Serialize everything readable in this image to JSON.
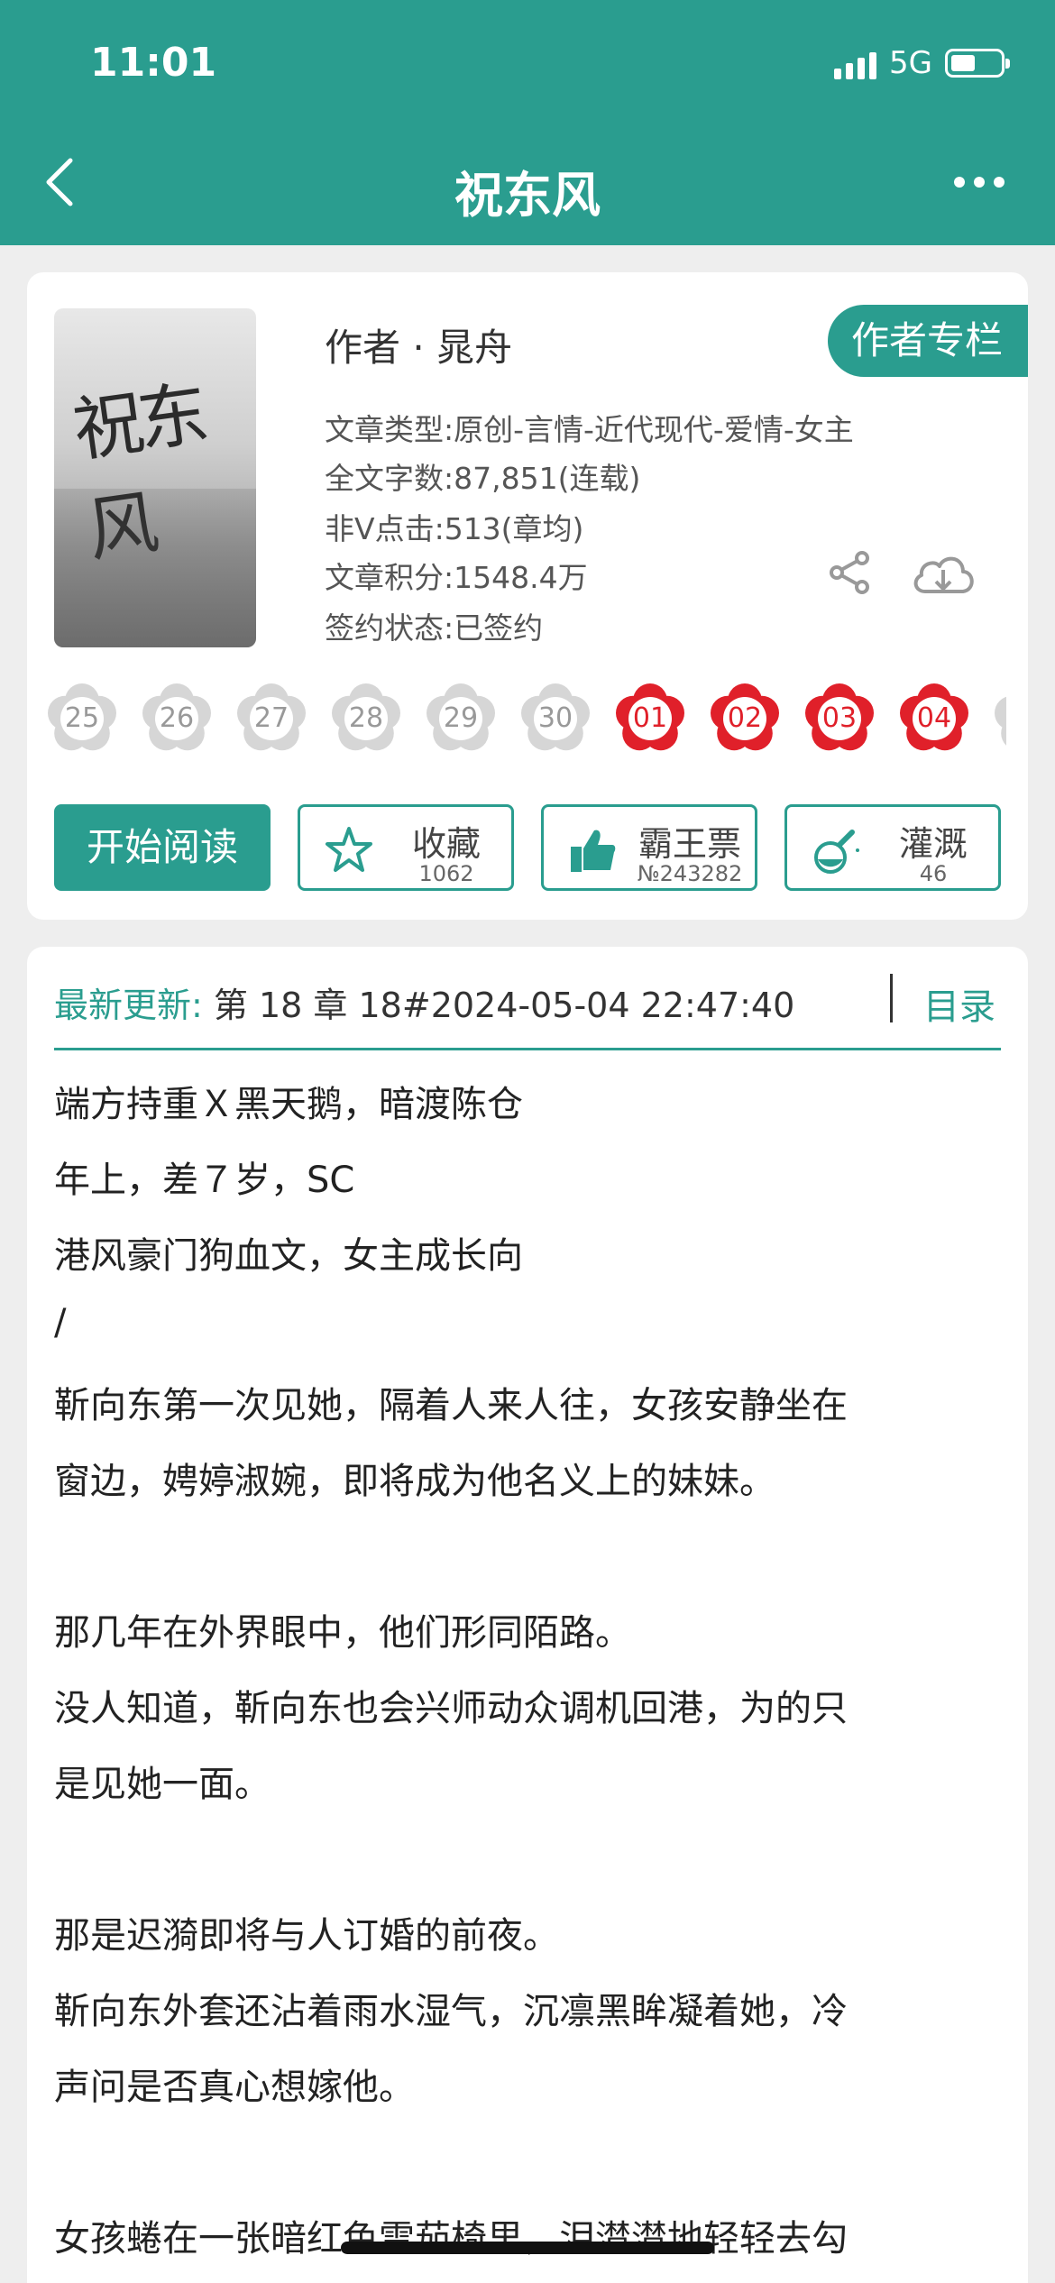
{
  "status": {
    "time": "11:01",
    "network": "5G"
  },
  "header": {
    "title": "祝东风"
  },
  "book": {
    "cover_title": "祝东风",
    "author": "作者 · 晁舟",
    "author_column_button": "作者专栏",
    "genre": "文章类型:原创-言情-近代现代-爱情-女主",
    "word_count": "全文字数:87,851(连载)",
    "clicks": "非Ⅴ点击:513(章均)",
    "score": "文章积分:1548.4万",
    "contract": "签约状态:已签约"
  },
  "chapters": [
    "25",
    "26",
    "27",
    "28",
    "29",
    "30",
    "01",
    "02",
    "03",
    "04"
  ],
  "actions": {
    "read": "开始阅读",
    "favorite": {
      "label": "收藏",
      "count": "1062"
    },
    "ticket": {
      "label": "霸王票",
      "count": "№243282"
    },
    "water": {
      "label": "灌溉",
      "count": "46"
    }
  },
  "update": {
    "label": "最新更新:",
    "chapter": "第 18 章 18#2024-05-04 22:47:40",
    "toc": "目录"
  },
  "intro": [
    "端方持重Ｘ黑天鹅，暗渡陈仓",
    "年上，差７岁，SC",
    "港风豪门狗血文，女主成长向",
    "/",
    "靳向东第一次见她，隔着人来人往，女孩安静坐在",
    "窗边，娉婷淑婉，即将成为他名义上的妹妹。",
    "那几年在外界眼中，他们形同陌路。",
    "没人知道，靳向东也会兴师动众调机回港，为的只",
    "是见她一面。",
    "那是迟漪即将与人订婚的前夜。",
    "靳向东外套还沾着雨水湿气，沉凛黑眸凝着她，冷",
    "声问是否真心想嫁他。",
    "女孩蜷在一张暗红色雪茄椅里，泪潸潸地轻轻去勾"
  ],
  "colors": {
    "accent": "#2a9d8f",
    "active_flower": "#e0202a",
    "inactive_flower": "#d6d6d6"
  }
}
